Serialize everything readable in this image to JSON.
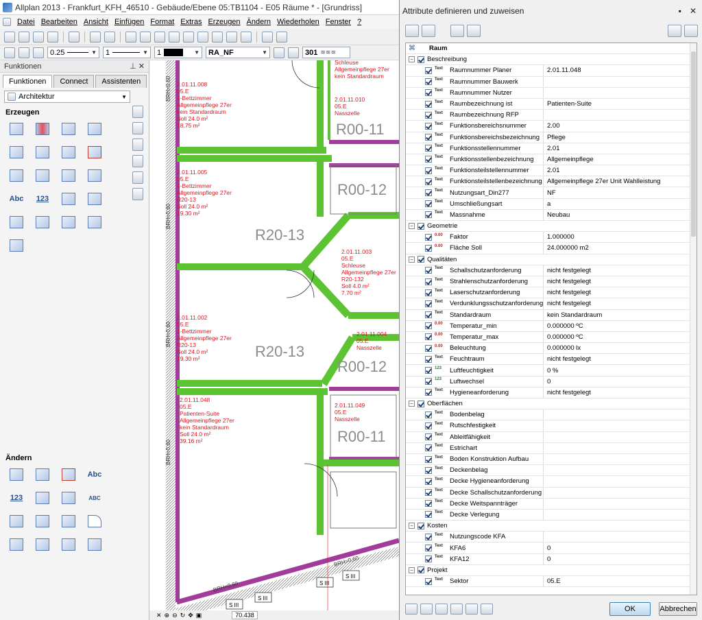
{
  "window": {
    "title": "Allplan 2013 - Frankfurt_KFH_46510 - Gebäude/Ebene 05:TB1104 - E05   Räume   * - [Grundriss]"
  },
  "menu": [
    "Datei",
    "Bearbeiten",
    "Ansicht",
    "Einfügen",
    "Format",
    "Extras",
    "Erzeugen",
    "Ändern",
    "Wiederholen",
    "Fenster",
    "?"
  ],
  "toolbar2": {
    "pen": "0.25",
    "line": "1",
    "color": "1",
    "layer": "RA_NF",
    "hatch": "301"
  },
  "left_panel": {
    "title": "Funktionen",
    "tabs": [
      "Funktionen",
      "Connect",
      "Assistenten"
    ],
    "module": "Architektur",
    "section_create": "Erzeugen",
    "section_modify": "Ändern",
    "create_icon_labels": [
      "",
      "",
      "",
      "",
      "",
      "",
      "",
      "",
      "",
      "",
      "",
      "",
      "Abc",
      "123",
      "",
      ""
    ],
    "modify_icon_labels": [
      "",
      "",
      "",
      "Abc",
      "123",
      "",
      "",
      "ABC",
      "",
      "",
      "",
      "",
      "",
      "",
      "",
      ""
    ]
  },
  "plan": {
    "rooms": [
      {
        "id": "r1",
        "text": [
          "2.01.11.008",
          "05.E",
          "1-Bettzimmer",
          "Allgemeinpflege 27er",
          "kein Standardraum",
          "Soll 24.0 m²",
          "18.75 m²"
        ]
      },
      {
        "id": "r2",
        "text": [
          "2.01.11.005",
          "05.E",
          "1-Bettzimmer",
          "Allgemeinpflege 27er",
          "R20-13",
          "Soll 24.0 m²",
          "19.30 m²"
        ]
      },
      {
        "id": "r3",
        "text": [
          "2.01.11.002",
          "05.E",
          "1-Bettzimmer",
          "Allgemeinpflege 27er",
          "R20-13",
          "Soll 24.0 m²",
          "19.30 m²"
        ]
      },
      {
        "id": "r4",
        "text": [
          "2.01.11.048",
          "05.E",
          "Patienten-Suite",
          "Allgemeinpflege 27er",
          "kein Standardraum",
          "Soll 24.0 m²",
          "39.16 m²"
        ]
      },
      {
        "id": "r5",
        "text": [
          "2.01.11.003",
          "05.E",
          "Schleuse",
          "Allgemeinpflege 27er",
          "R20-132",
          "Soll 4.0 m²",
          "7.70 m²"
        ]
      },
      {
        "id": "r6",
        "text": [
          "2.01.11.004",
          "05.E",
          "Nasszelle"
        ]
      },
      {
        "id": "r7",
        "text": [
          "2.01.11.049",
          "05.E",
          "Nasszelle"
        ]
      },
      {
        "id": "r8",
        "text": [
          "2.01.11.010",
          "05.E",
          "Nasszelle"
        ]
      },
      {
        "id": "r9",
        "text": [
          "Schleuse",
          "Allgemeinpflege 27er",
          "kein Standardraum"
        ]
      }
    ],
    "big_labels": [
      "R00-11",
      "R00-12",
      "R20-13",
      "R20-13",
      "R00-12",
      "R00-11"
    ],
    "wall_labels": [
      "BRH=0,60",
      "BRH=0,60",
      "BRH=0,60",
      "BRH=0,60",
      "BRH=0,60",
      "BRH=0,60"
    ],
    "socket_label": "S III",
    "zoom": "70.438"
  },
  "dialog": {
    "title": "Attribute definieren und zuweisen",
    "root": "Raum",
    "ok": "OK",
    "cancel": "Abbrechen",
    "groups": [
      {
        "name": "Beschreibung",
        "rows": [
          {
            "t": "text",
            "label": "Raumnummer Planer",
            "value": "2.01.11.048"
          },
          {
            "t": "text",
            "label": "Raumnummer Bauwerk",
            "value": ""
          },
          {
            "t": "text",
            "label": "Raumnummer Nutzer",
            "value": ""
          },
          {
            "t": "text",
            "label": "Raumbezeichnung ist",
            "value": "Patienten-Suite"
          },
          {
            "t": "text",
            "label": "Raumbezeichnung RFP",
            "value": ""
          },
          {
            "t": "text",
            "label": "Funktionsbereichsnummer",
            "value": "2.00"
          },
          {
            "t": "text",
            "label": "Funktionsbereichsbezeichnung",
            "value": "Pflege"
          },
          {
            "t": "text",
            "label": "Funktionsstellennummer",
            "value": "2.01"
          },
          {
            "t": "text",
            "label": "Funktionsstellenbezeichnung",
            "value": "Allgemeinpflege"
          },
          {
            "t": "text",
            "label": "Funktionsteilstellennummer",
            "value": "2.01"
          },
          {
            "t": "text",
            "label": "Funktionsteilstellenbezeichnung",
            "value": "Allgemeinpflege 27er Unit Wahlleistung"
          },
          {
            "t": "text",
            "label": "Nutzungsart_Din277",
            "value": "NF"
          },
          {
            "t": "text",
            "label": "Umschließungsart",
            "value": "a"
          },
          {
            "t": "text",
            "label": "Massnahme",
            "value": "Neubau"
          }
        ]
      },
      {
        "name": "Geometrie",
        "rows": [
          {
            "t": "num",
            "label": "Faktor",
            "value": "1.000000"
          },
          {
            "t": "num",
            "label": "Fläche Soll",
            "value": "24.000000 m2"
          }
        ]
      },
      {
        "name": "Qualitäten",
        "rows": [
          {
            "t": "text",
            "label": "Schallschutzanforderung",
            "value": "nicht festgelegt"
          },
          {
            "t": "text",
            "label": "Strahlenschutzanforderung",
            "value": "nicht festgelegt"
          },
          {
            "t": "text",
            "label": "Laserschutzanforderung",
            "value": "nicht festgelegt"
          },
          {
            "t": "text",
            "label": "Verdunklungsschutzanforderung",
            "value": "nicht festgelegt"
          },
          {
            "t": "text",
            "label": "Standardraum",
            "value": "kein Standardraum"
          },
          {
            "t": "num",
            "label": "Temperatur_min",
            "value": "0.000000 ºC"
          },
          {
            "t": "num",
            "label": "Temperatur_max",
            "value": "0.000000 ºC"
          },
          {
            "t": "num",
            "label": "Beleuchtung",
            "value": "0.000000 lx"
          },
          {
            "t": "text",
            "label": "Feuchtraum",
            "value": "nicht festgelegt"
          },
          {
            "t": "int",
            "label": "Luftfeuchtigkeit",
            "value": "0 %"
          },
          {
            "t": "int",
            "label": "Luftwechsel",
            "value": "0"
          },
          {
            "t": "text",
            "label": "Hygieneanforderung",
            "value": "nicht festgelegt"
          }
        ]
      },
      {
        "name": "Oberflächen",
        "rows": [
          {
            "t": "text",
            "label": "Bodenbelag",
            "value": ""
          },
          {
            "t": "text",
            "label": "Rutschfestigkeit",
            "value": ""
          },
          {
            "t": "text",
            "label": "Ableitfähigkeit",
            "value": ""
          },
          {
            "t": "text",
            "label": "Estrichart",
            "value": ""
          },
          {
            "t": "text",
            "label": "Boden Konstruktion Aufbau",
            "value": ""
          },
          {
            "t": "text",
            "label": "Deckenbelag",
            "value": ""
          },
          {
            "t": "text",
            "label": "Decke Hygieneanforderung",
            "value": ""
          },
          {
            "t": "text",
            "label": "Decke Schallschutzanforderung",
            "value": ""
          },
          {
            "t": "text",
            "label": "Decke Weitspannträger",
            "value": ""
          },
          {
            "t": "text",
            "label": "Decke Verlegung",
            "value": ""
          }
        ]
      },
      {
        "name": "Kosten",
        "rows": [
          {
            "t": "text",
            "label": "Nutzungscode KFA",
            "value": ""
          },
          {
            "t": "text",
            "label": "KFA6",
            "value": "0"
          },
          {
            "t": "text",
            "label": "KFA12",
            "value": "0"
          }
        ]
      },
      {
        "name": "Projekt",
        "rows": [
          {
            "t": "text",
            "label": "Sektor",
            "value": "05.E"
          }
        ]
      }
    ],
    "type_icons": {
      "text": "Text",
      "num": "0.00",
      "int": "123"
    }
  },
  "colors": {
    "wall_green": "#5cc432",
    "wall_purple": "#a23c9a",
    "room_text": "#e0141e",
    "label_gray": "#8c8c8c"
  }
}
